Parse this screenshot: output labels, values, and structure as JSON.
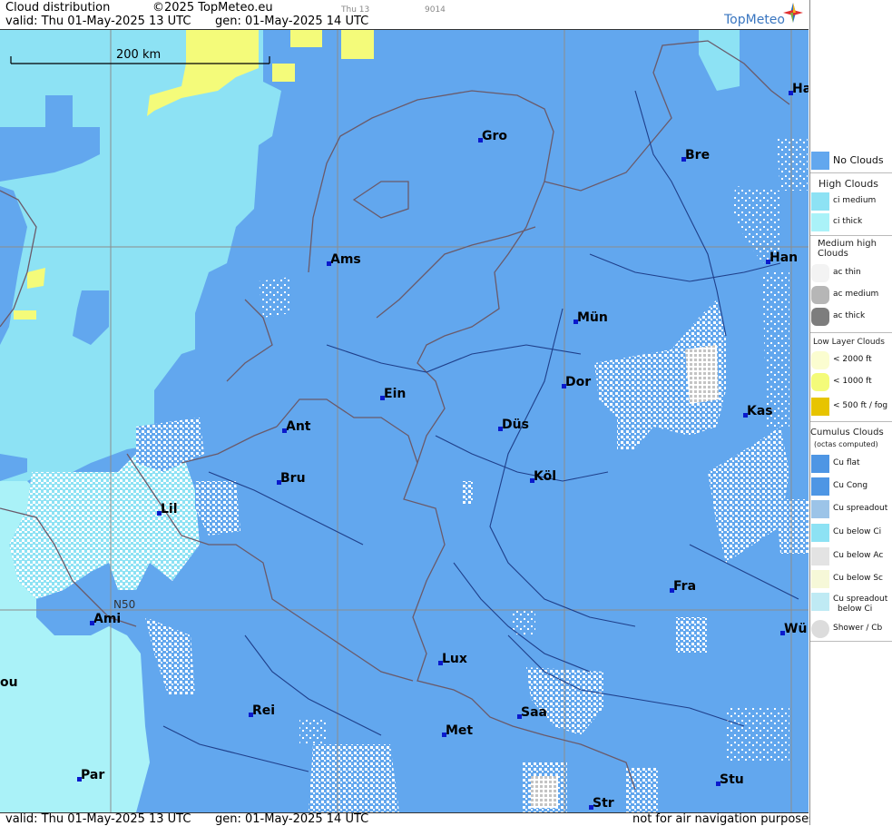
{
  "header": {
    "title": "Cloud distribution",
    "copyright": "©2025 TopMeteo.eu",
    "run_hint": "Thu 13",
    "code_hint": "9014",
    "valid": "valid:  Thu  01-May-2025  13 UTC",
    "gen": "gen: 01-May-2025 14 UTC",
    "brand": "TopMeteo"
  },
  "footer": {
    "valid": "valid:  Thu  01-May-2025  13 UTC",
    "gen": "gen: 01-May-2025 14 UTC",
    "disclaimer": "not for air navigation purposes"
  },
  "map": {
    "scale_label": "200 km",
    "lat_label": "N50",
    "colors": {
      "no_clouds": "#62a7ee",
      "ci_medium": "#8de2f4",
      "ci_thick": "#aaf2f8",
      "low_below_1000": "#f4fb7a",
      "cu_white": "#ffffff",
      "cu_grey": "#c9c9c9",
      "borders": "#6a5a6a",
      "rivers": "#1f3f8a",
      "city_dot": "#0a1acc"
    },
    "cities": [
      {
        "name": "Gro"
      },
      {
        "name": "Bre"
      },
      {
        "name": "Ha"
      },
      {
        "name": "Ams"
      },
      {
        "name": "Han"
      },
      {
        "name": "Mün"
      },
      {
        "name": "Ein"
      },
      {
        "name": "Dor"
      },
      {
        "name": "Kas"
      },
      {
        "name": "Ant"
      },
      {
        "name": "Düs"
      },
      {
        "name": "Bru"
      },
      {
        "name": "Köl"
      },
      {
        "name": "Lil"
      },
      {
        "name": "Fra"
      },
      {
        "name": "Ami"
      },
      {
        "name": "Wü"
      },
      {
        "name": "Lux"
      },
      {
        "name": "ou"
      },
      {
        "name": "Rei"
      },
      {
        "name": "Saa"
      },
      {
        "name": "Met"
      },
      {
        "name": "Stu"
      },
      {
        "name": "Par"
      },
      {
        "name": "Str"
      }
    ]
  },
  "legend": {
    "no_clouds": "No Clouds",
    "high_clouds": "High Clouds",
    "ci_medium": "ci medium",
    "ci_thick": "ci thick",
    "medium_high": "Medium high Clouds",
    "ac_thin": "ac thin",
    "ac_medium": "ac medium",
    "ac_thick": "ac thick",
    "low_layer": "Low Layer Clouds",
    "lt2000": "< 2000 ft",
    "lt1000": "< 1000 ft",
    "lt500": "< 500 ft / fog",
    "cumulus": "Cumulus Clouds",
    "octas": "(octas computed)",
    "cu_flat": "Cu flat",
    "cu_cong": "Cu Cong",
    "cu_spreadout": "Cu spreadout",
    "cu_below_ci": "Cu below Ci",
    "cu_below_ac": "Cu below Ac",
    "cu_below_sc": "Cu below Sc",
    "cu_spreadout_below_ci_1": "Cu spreadout",
    "cu_spreadout_below_ci_2": "below Ci",
    "shower": "Shower / Cb"
  }
}
